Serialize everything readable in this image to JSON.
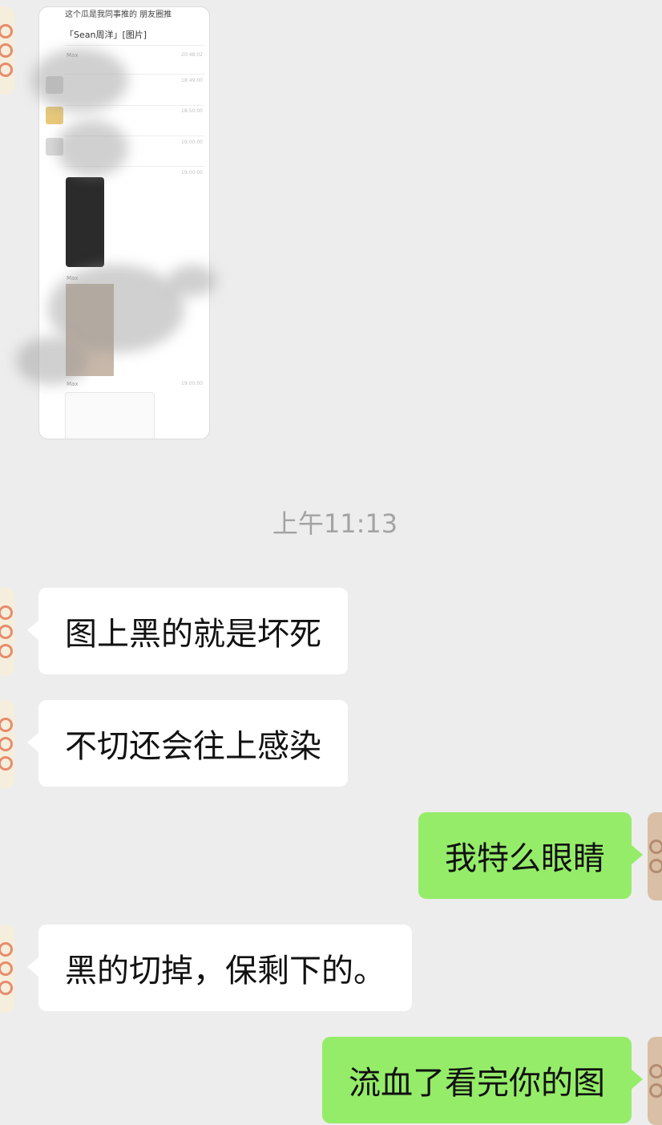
{
  "screenshot_message": {
    "header_line": "这个瓜是我同事推的 朋友圈推",
    "quote_line": "「Sean周洋」[图片]",
    "rows": [
      {
        "sender": "Max",
        "time": "20:48:02"
      },
      {
        "sender": "",
        "time": "18:49:00"
      },
      {
        "sender": "",
        "time": "18:50:00"
      },
      {
        "sender": "",
        "time": "19:00:00"
      },
      {
        "sender": "",
        "time": "19:00:00"
      },
      {
        "sender": "Max",
        "time": ""
      },
      {
        "sender": "Max",
        "time": "19:00:00"
      }
    ]
  },
  "timestamp": "上午11:13",
  "messages": [
    {
      "side": "left",
      "text": "图上黑的就是坏死"
    },
    {
      "side": "left",
      "text": "不切还会往上感染"
    },
    {
      "side": "right",
      "text": "我特么眼睛"
    },
    {
      "side": "left",
      "text": "黑的切掉，保剩下的。"
    },
    {
      "side": "right",
      "text": "流血了看完你的图"
    }
  ]
}
